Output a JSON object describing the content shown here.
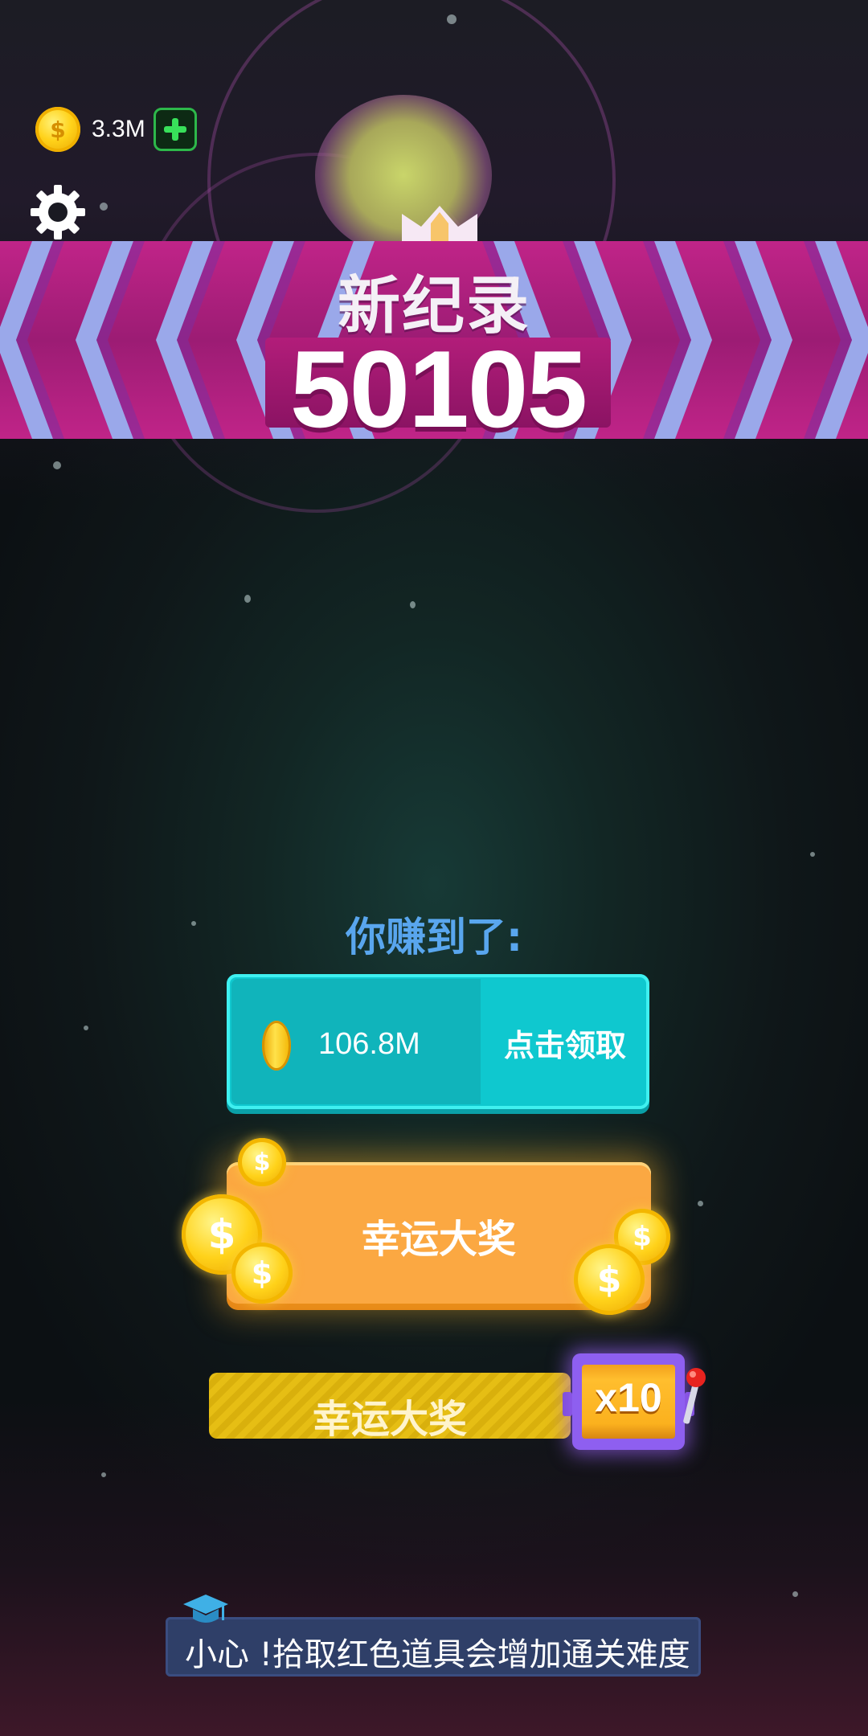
{
  "hud": {
    "coin_balance": "3.3M",
    "coin_icon": "dollar-coin-icon",
    "add_coins_icon": "plus-icon",
    "settings_icon": "gear-icon"
  },
  "banner": {
    "title": "新纪录",
    "score": "50105",
    "crown_icon": "crown-icon"
  },
  "reward": {
    "earned_label": "你赚到了:",
    "amount": "106.8M",
    "claim_label": "点击领取"
  },
  "lucky_prize": {
    "label": "幸运大奖",
    "coin_symbol": "$"
  },
  "slot": {
    "label": "幸运大奖",
    "multiplier": "x10"
  },
  "tip": {
    "text": "小心 !拾取红色道具会增加通关难度",
    "icon": "graduation-cap-icon"
  },
  "colors": {
    "banner_magenta": "#b21d7a",
    "banner_chevron": "#9aa8ea",
    "claim_cyan": "#0fc8cf",
    "lucky_orange": "#fba842",
    "slot_yellow": "#e6be14",
    "slot_purple": "#8e5ff0",
    "earned_blue": "#59a6ee",
    "tip_navy": "#2f3f68"
  }
}
